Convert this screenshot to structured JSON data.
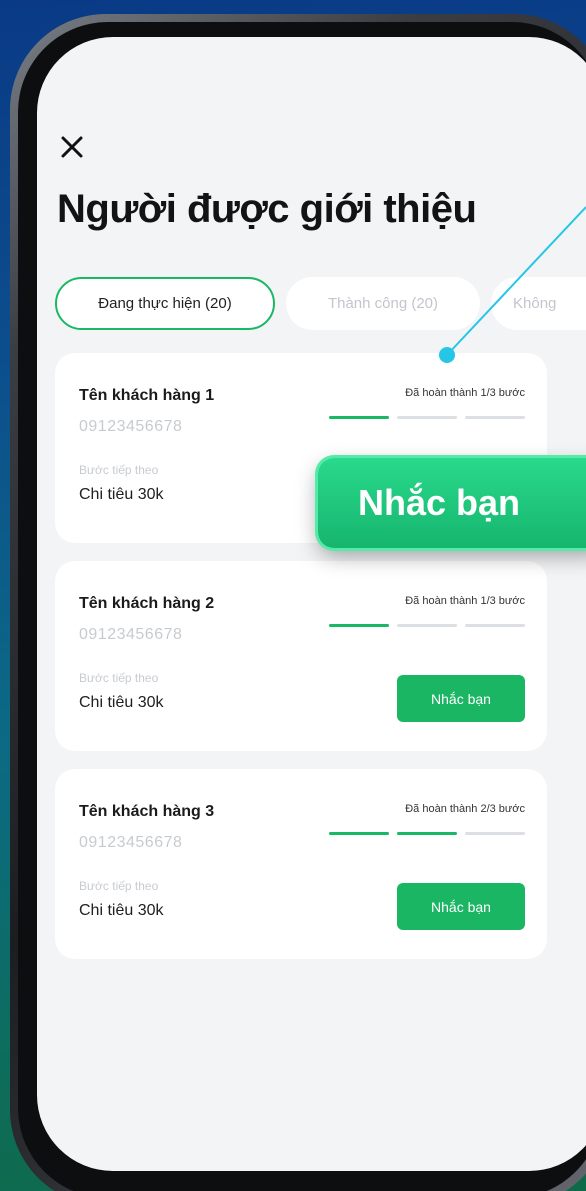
{
  "screen": {
    "title": "Người được giới thiệu",
    "close_icon": "close-icon"
  },
  "tabs": [
    {
      "label": "Đang thực hiện (20)",
      "active": true
    },
    {
      "label": "Thành công (20)",
      "active": false
    },
    {
      "label": "Không",
      "active": false
    }
  ],
  "cards": [
    {
      "name": "Tên khách hàng 1",
      "phone": "09123456678",
      "next_label": "Bước tiếp theo",
      "next_value": "Chi tiêu 30k",
      "progress_text": "Đã hoàn thành 1/3 bước",
      "steps_done": 1,
      "steps_total": 3
    },
    {
      "name": "Tên khách hàng 2",
      "phone": "09123456678",
      "next_label": "Bước tiếp theo",
      "next_value": "Chi tiêu 30k",
      "progress_text": "Đã hoàn thành 1/3 bước",
      "steps_done": 1,
      "steps_total": 3,
      "button_label": "Nhắc bạn"
    },
    {
      "name": "Tên khách hàng 3",
      "phone": "09123456678",
      "next_label": "Bước tiếp theo",
      "next_value": "Chi tiêu 30k",
      "progress_text": "Đã hoàn thành 2/3 bước",
      "steps_done": 2,
      "steps_total": 3,
      "button_label": "Nhắc bạn"
    }
  ],
  "callout": {
    "label": "Nhắc bạn"
  },
  "colors": {
    "accent": "#19b864",
    "background": "#f3f4f6",
    "callout_line": "#25c6e6"
  }
}
